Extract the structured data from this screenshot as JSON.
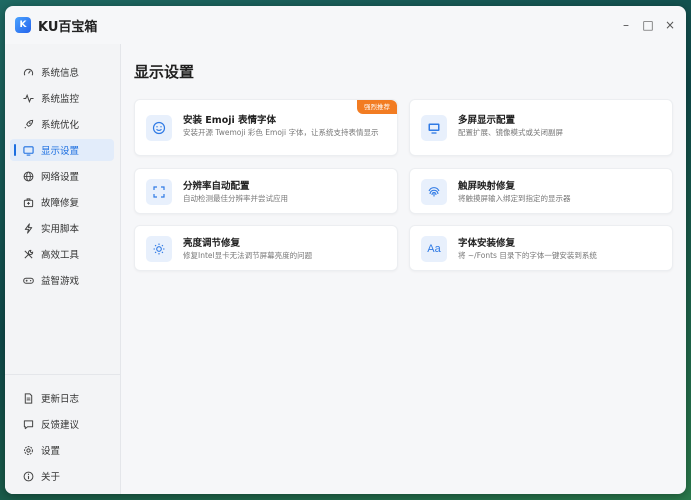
{
  "window": {
    "title": "KU百宝箱",
    "logo_text": "K",
    "controls": [
      "–",
      "□",
      "×"
    ]
  },
  "sidebar": {
    "items": [
      {
        "label": "系统信息",
        "icon": "gauge-icon"
      },
      {
        "label": "系统监控",
        "icon": "pulse-icon"
      },
      {
        "label": "系统优化",
        "icon": "rocket-icon"
      },
      {
        "label": "显示设置",
        "icon": "monitor-icon",
        "active": true
      },
      {
        "label": "网络设置",
        "icon": "globe-icon"
      },
      {
        "label": "故障修复",
        "icon": "toolbox-icon"
      },
      {
        "label": "实用脚本",
        "icon": "lightning-icon"
      },
      {
        "label": "高效工具",
        "icon": "tools-icon"
      },
      {
        "label": "益智游戏",
        "icon": "gamepad-icon"
      }
    ],
    "footer": [
      {
        "label": "更新日志",
        "icon": "document-icon"
      },
      {
        "label": "反馈建议",
        "icon": "chat-icon"
      },
      {
        "label": "设置",
        "icon": "gear-icon"
      },
      {
        "label": "关于",
        "icon": "info-icon"
      }
    ]
  },
  "main": {
    "title": "显示设置",
    "cards": [
      {
        "title": "安装 Emoji 表情字体",
        "desc": "安装开源 Twemoji 彩色 Emoji 字体，让系统支持表情显示",
        "badge": "强烈推荐",
        "icon": "smiley-icon"
      },
      {
        "title": "多屏显示配置",
        "desc": "配置扩展、镜像模式或关闭副屏",
        "icon": "monitor-icon"
      },
      {
        "title": "分辨率自动配置",
        "desc": "自动检测最佳分辨率并尝试应用",
        "icon": "fullscreen-icon"
      },
      {
        "title": "触屏映射修复",
        "desc": "将触摸屏输入绑定到指定的显示器",
        "icon": "fingerprint-icon"
      },
      {
        "title": "亮度调节修复",
        "desc": "修复Intel显卡无法调节屏幕亮度的问题",
        "icon": "brightness-icon"
      },
      {
        "title": "字体安装修复",
        "desc": "将 ~/Fonts 目录下的字体一键安装到系统",
        "icon": "font-icon",
        "icon_text": "Aa"
      }
    ]
  },
  "colors": {
    "accent": "#1d6fe0",
    "badge": "#f27c22",
    "icon_bg": "#e8f0fc"
  }
}
